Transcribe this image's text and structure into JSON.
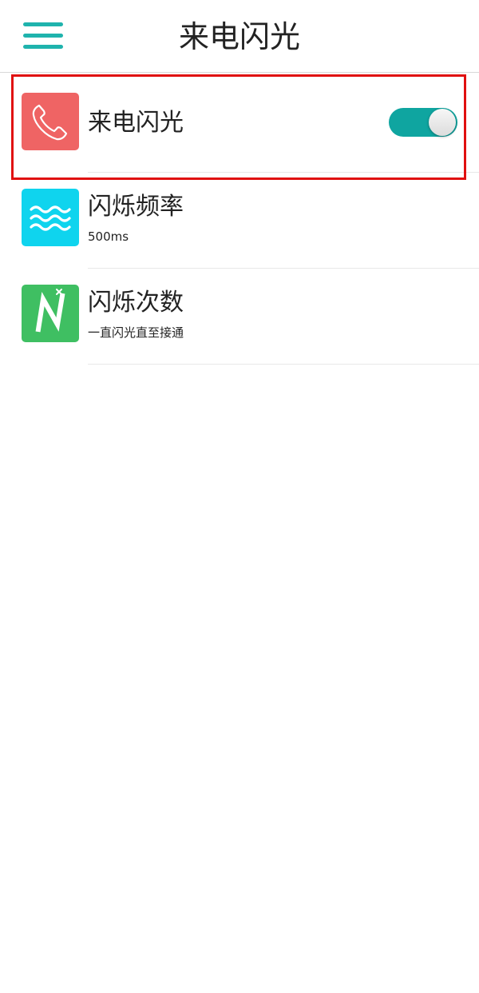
{
  "header": {
    "title": "来电闪光",
    "menu_icon": "hamburger-menu-icon",
    "accent_color": "#1fb3ad"
  },
  "settings": [
    {
      "title": "来电闪光",
      "subtitle": "",
      "icon": "phone-icon",
      "icon_bg": "#ef6464",
      "toggle_on": true
    },
    {
      "title": "闪烁频率",
      "subtitle": "500ms",
      "icon": "waves-icon",
      "icon_bg": "#0fd4ee"
    },
    {
      "title": "闪烁次数",
      "subtitle": "一直闪光直至接通",
      "icon": "letter-n-icon",
      "icon_bg": "#3fbf62"
    }
  ],
  "colors": {
    "toggle_track": "#0fa5a0",
    "highlight": "#e01010"
  }
}
